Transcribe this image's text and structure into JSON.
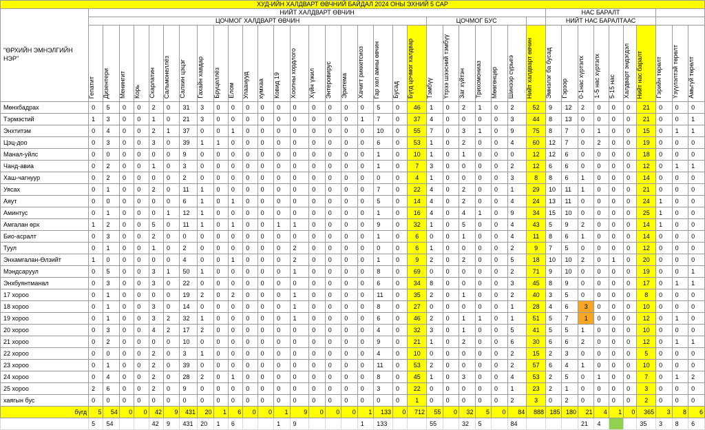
{
  "title": "ХУД-ИЙН ХАЛДВАРТ ӨВЧНИЙ БАЙДАЛ 2024 ОНЫ ЭХНИЙ 5 САР",
  "header_groups": {
    "total_infectious": "НИЙТ ХАЛДВАРТ ӨВЧИН",
    "acute_infectious": "ЦОЧМОГ ХАЛДВАРТ ӨВЧИН",
    "acute_other": "ЦОЧМОГ БУС",
    "deaths": "НАС БАРАЛТ",
    "of_total_deaths": "НИЙТ НАС БАРАЛТААС",
    "row_header": "\"ӨРХИЙН ЭМНЭЛГИЙН НЭР\""
  },
  "columns": [
    "Гепатит",
    "Дизентери",
    "Менингит",
    "Корь",
    "Скарлатин",
    "Сальмонеллёз",
    "Салхин цэцэг",
    "Гахайн хавдар",
    "Бруцеллёз",
    "Ёлом",
    "Улаанууд",
    "хумхаа",
    "Ковид 19",
    "Хоолны хордлого",
    "Хүйн үжил",
    "Энтеровирус",
    "Эритема",
    "Хачигт риккетсиоз",
    "Гар хөл амны өвчин",
    "Бусад",
    "Бүгд цочмог халдвар",
    "Тэмбүү",
    "Үтрээ шээсний тэмбүү",
    "Заг хүйтэн",
    "Трихомониаз",
    "Мөөгөнцөр",
    "Шинээр сүрьеэ",
    "Нийт халдварт өвчин",
    "Эмнэлэг ба бусад",
    "Гэрээр",
    "0-1нас хүртэлх",
    "1-5 нас хүртэлх",
    "5-15 нас",
    "Халдварт эндэгдэл",
    "Нийт нас баралт",
    "Гэрийн төрөлт",
    "Үзүүлэлтэй төрөлт",
    "Амьгүй төрөлт"
  ],
  "highlight_cols": [
    20,
    27,
    34
  ],
  "rows": [
    {
      "name": "Мөнхбадрах",
      "v": [
        "0",
        "5",
        "0",
        "0",
        "2",
        "0",
        "31",
        "3",
        "0",
        "0",
        "0",
        "0",
        "0",
        "0",
        "0",
        "0",
        "0",
        "0",
        "5",
        "0",
        "46",
        "1",
        "0",
        "2",
        "1",
        "0",
        "2",
        "52",
        "9",
        "12",
        "2",
        "0",
        "0",
        "0",
        "21",
        "0",
        "0",
        "0"
      ]
    },
    {
      "name": "Тэрмэстий",
      "v": [
        "1",
        "3",
        "0",
        "0",
        "1",
        "0",
        "21",
        "3",
        "0",
        "0",
        "0",
        "0",
        "0",
        "0",
        "0",
        "0",
        "0",
        "1",
        "7",
        "0",
        "37",
        "4",
        "0",
        "0",
        "0",
        "0",
        "3",
        "44",
        "8",
        "13",
        "0",
        "0",
        "0",
        "0",
        "21",
        "0",
        "0",
        "1"
      ]
    },
    {
      "name": "Энхтитэм",
      "v": [
        "0",
        "4",
        "0",
        "0",
        "2",
        "1",
        "37",
        "0",
        "0",
        "1",
        "0",
        "0",
        "0",
        "0",
        "0",
        "0",
        "0",
        "0",
        "10",
        "0",
        "55",
        "7",
        "0",
        "3",
        "1",
        "0",
        "9",
        "75",
        "8",
        "7",
        "0",
        "1",
        "0",
        "0",
        "15",
        "0",
        "1",
        "1"
      ]
    },
    {
      "name": "Цэц-доо",
      "v": [
        "0",
        "3",
        "0",
        "0",
        "3",
        "0",
        "39",
        "1",
        "1",
        "0",
        "0",
        "0",
        "0",
        "0",
        "0",
        "0",
        "0",
        "0",
        "6",
        "0",
        "53",
        "1",
        "0",
        "2",
        "0",
        "0",
        "4",
        "60",
        "12",
        "7",
        "0",
        "2",
        "0",
        "0",
        "19",
        "0",
        "0",
        "0"
      ]
    },
    {
      "name": "Манал-уйлс",
      "v": [
        "0",
        "0",
        "0",
        "0",
        "0",
        "0",
        "9",
        "0",
        "0",
        "0",
        "0",
        "0",
        "0",
        "0",
        "0",
        "0",
        "0",
        "0",
        "1",
        "0",
        "10",
        "1",
        "0",
        "1",
        "0",
        "0",
        "0",
        "12",
        "12",
        "6",
        "0",
        "0",
        "0",
        "0",
        "18",
        "0",
        "0",
        "0"
      ]
    },
    {
      "name": "Чанд-авиа",
      "v": [
        "0",
        "2",
        "0",
        "0",
        "1",
        "0",
        "3",
        "0",
        "0",
        "0",
        "0",
        "0",
        "0",
        "0",
        "0",
        "0",
        "0",
        "0",
        "1",
        "0",
        "7",
        "3",
        "0",
        "0",
        "0",
        "0",
        "2",
        "12",
        "6",
        "6",
        "0",
        "0",
        "0",
        "0",
        "12",
        "0",
        "1",
        "1"
      ]
    },
    {
      "name": "Хаш-чагнуур",
      "v": [
        "0",
        "2",
        "0",
        "0",
        "0",
        "0",
        "2",
        "0",
        "0",
        "0",
        "0",
        "0",
        "0",
        "0",
        "0",
        "0",
        "0",
        "0",
        "0",
        "0",
        "4",
        "1",
        "0",
        "0",
        "0",
        "0",
        "3",
        "8",
        "8",
        "6",
        "1",
        "0",
        "0",
        "0",
        "14",
        "0",
        "0",
        "0"
      ]
    },
    {
      "name": "Уясах",
      "v": [
        "0",
        "1",
        "0",
        "0",
        "2",
        "0",
        "11",
        "1",
        "0",
        "0",
        "0",
        "0",
        "0",
        "0",
        "0",
        "0",
        "0",
        "0",
        "7",
        "0",
        "22",
        "4",
        "0",
        "2",
        "0",
        "0",
        "1",
        "29",
        "10",
        "11",
        "1",
        "0",
        "0",
        "0",
        "21",
        "0",
        "0",
        "0"
      ]
    },
    {
      "name": "Аяут",
      "v": [
        "0",
        "0",
        "0",
        "0",
        "0",
        "0",
        "6",
        "1",
        "0",
        "1",
        "0",
        "0",
        "0",
        "0",
        "0",
        "0",
        "0",
        "0",
        "5",
        "0",
        "14",
        "4",
        "0",
        "2",
        "0",
        "0",
        "4",
        "24",
        "13",
        "11",
        "0",
        "0",
        "0",
        "0",
        "24",
        "1",
        "0",
        "0"
      ]
    },
    {
      "name": "Аминтус",
      "v": [
        "0",
        "1",
        "0",
        "0",
        "0",
        "1",
        "12",
        "1",
        "0",
        "0",
        "0",
        "0",
        "0",
        "0",
        "0",
        "0",
        "0",
        "0",
        "1",
        "0",
        "16",
        "4",
        "0",
        "4",
        "1",
        "0",
        "9",
        "34",
        "15",
        "10",
        "0",
        "0",
        "0",
        "0",
        "25",
        "1",
        "0",
        "0"
      ]
    },
    {
      "name": "Амгалан өрх",
      "v": [
        "1",
        "2",
        "0",
        "0",
        "5",
        "0",
        "11",
        "1",
        "0",
        "1",
        "0",
        "0",
        "1",
        "1",
        "0",
        "0",
        "0",
        "0",
        "9",
        "0",
        "32",
        "1",
        "0",
        "5",
        "0",
        "0",
        "4",
        "43",
        "5",
        "9",
        "2",
        "0",
        "0",
        "0",
        "14",
        "1",
        "0",
        "0"
      ]
    },
    {
      "name": "Био-асралт",
      "v": [
        "0",
        "3",
        "0",
        "0",
        "2",
        "0",
        "0",
        "0",
        "0",
        "0",
        "0",
        "0",
        "0",
        "0",
        "0",
        "0",
        "0",
        "0",
        "1",
        "0",
        "6",
        "0",
        "0",
        "1",
        "0",
        "0",
        "4",
        "11",
        "8",
        "6",
        "1",
        "0",
        "0",
        "0",
        "14",
        "0",
        "0",
        "0"
      ]
    },
    {
      "name": "Туул",
      "v": [
        "0",
        "1",
        "0",
        "0",
        "1",
        "0",
        "2",
        "0",
        "0",
        "0",
        "0",
        "0",
        "0",
        "2",
        "0",
        "0",
        "0",
        "0",
        "0",
        "0",
        "6",
        "1",
        "0",
        "0",
        "0",
        "0",
        "2",
        "9",
        "7",
        "5",
        "0",
        "0",
        "0",
        "0",
        "12",
        "0",
        "0",
        "0"
      ]
    },
    {
      "name": "Энхамгалан-Өлзийт",
      "v": [
        "1",
        "0",
        "0",
        "0",
        "0",
        "0",
        "4",
        "0",
        "0",
        "1",
        "0",
        "0",
        "0",
        "2",
        "0",
        "0",
        "0",
        "0",
        "1",
        "0",
        "9",
        "2",
        "0",
        "2",
        "0",
        "0",
        "5",
        "18",
        "10",
        "10",
        "2",
        "0",
        "1",
        "0",
        "20",
        "0",
        "0",
        "0"
      ]
    },
    {
      "name": "Мэндсаруул",
      "v": [
        "0",
        "5",
        "0",
        "0",
        "3",
        "1",
        "50",
        "1",
        "0",
        "0",
        "0",
        "0",
        "0",
        "1",
        "0",
        "0",
        "0",
        "0",
        "8",
        "0",
        "69",
        "0",
        "0",
        "0",
        "0",
        "0",
        "2",
        "71",
        "9",
        "10",
        "0",
        "0",
        "0",
        "0",
        "19",
        "0",
        "0",
        "1"
      ]
    },
    {
      "name": "Энхбуянтманал",
      "v": [
        "0",
        "3",
        "0",
        "0",
        "3",
        "0",
        "22",
        "0",
        "0",
        "0",
        "0",
        "0",
        "0",
        "0",
        "0",
        "0",
        "0",
        "0",
        "6",
        "0",
        "34",
        "8",
        "0",
        "0",
        "0",
        "0",
        "3",
        "45",
        "8",
        "9",
        "0",
        "0",
        "0",
        "0",
        "17",
        "0",
        "1",
        "1"
      ]
    },
    {
      "name": "17 хороо",
      "v": [
        "0",
        "1",
        "0",
        "0",
        "0",
        "0",
        "19",
        "2",
        "0",
        "2",
        "0",
        "0",
        "0",
        "1",
        "0",
        "0",
        "0",
        "0",
        "11",
        "0",
        "35",
        "2",
        "0",
        "1",
        "0",
        "0",
        "2",
        "40",
        "3",
        "5",
        "0",
        "0",
        "0",
        "0",
        "8",
        "0",
        "0",
        "0"
      ]
    },
    {
      "name": "18 хороо",
      "v": [
        "0",
        "1",
        "0",
        "0",
        "3",
        "0",
        "14",
        "0",
        "0",
        "0",
        "0",
        "0",
        "0",
        "1",
        "0",
        "0",
        "0",
        "0",
        "8",
        "0",
        "27",
        "0",
        "0",
        "0",
        "0",
        "0",
        "1",
        "28",
        "4",
        "6",
        "3",
        "0",
        "0",
        "0",
        "10",
        "0",
        "0",
        "0"
      ]
    },
    {
      "name": "19 хороо",
      "v": [
        "0",
        "1",
        "0",
        "0",
        "3",
        "2",
        "32",
        "1",
        "0",
        "0",
        "0",
        "0",
        "0",
        "1",
        "0",
        "0",
        "0",
        "0",
        "6",
        "0",
        "46",
        "2",
        "0",
        "1",
        "1",
        "0",
        "1",
        "51",
        "5",
        "7",
        "1",
        "0",
        "0",
        "0",
        "12",
        "0",
        "1",
        "0"
      ]
    },
    {
      "name": "20 хороо",
      "v": [
        "0",
        "3",
        "0",
        "0",
        "4",
        "2",
        "17",
        "2",
        "0",
        "0",
        "0",
        "0",
        "0",
        "0",
        "0",
        "0",
        "0",
        "0",
        "4",
        "0",
        "32",
        "3",
        "0",
        "1",
        "0",
        "0",
        "5",
        "41",
        "5",
        "5",
        "1",
        "0",
        "0",
        "0",
        "10",
        "0",
        "0",
        "0"
      ]
    },
    {
      "name": "21 хороо",
      "v": [
        "0",
        "2",
        "0",
        "0",
        "0",
        "0",
        "10",
        "0",
        "0",
        "0",
        "0",
        "0",
        "0",
        "0",
        "0",
        "0",
        "0",
        "0",
        "9",
        "0",
        "21",
        "1",
        "0",
        "2",
        "0",
        "0",
        "6",
        "30",
        "6",
        "6",
        "2",
        "0",
        "0",
        "0",
        "12",
        "0",
        "1",
        "1"
      ]
    },
    {
      "name": "22 хороо",
      "v": [
        "0",
        "0",
        "0",
        "0",
        "2",
        "0",
        "3",
        "1",
        "0",
        "0",
        "0",
        "0",
        "0",
        "0",
        "0",
        "0",
        "0",
        "0",
        "4",
        "0",
        "10",
        "0",
        "0",
        "0",
        "0",
        "0",
        "2",
        "15",
        "2",
        "3",
        "0",
        "0",
        "0",
        "0",
        "5",
        "0",
        "0",
        "0"
      ]
    },
    {
      "name": "23 хороо",
      "v": [
        "0",
        "1",
        "0",
        "0",
        "2",
        "0",
        "39",
        "0",
        "0",
        "0",
        "0",
        "0",
        "0",
        "0",
        "0",
        "0",
        "0",
        "0",
        "11",
        "0",
        "53",
        "2",
        "0",
        "0",
        "0",
        "0",
        "2",
        "57",
        "6",
        "4",
        "1",
        "0",
        "0",
        "0",
        "10",
        "0",
        "0",
        "0"
      ]
    },
    {
      "name": "24 хороо",
      "v": [
        "0",
        "4",
        "0",
        "0",
        "2",
        "0",
        "28",
        "2",
        "0",
        "1",
        "0",
        "0",
        "0",
        "0",
        "0",
        "0",
        "0",
        "0",
        "8",
        "0",
        "45",
        "1",
        "0",
        "3",
        "0",
        "0",
        "4",
        "53",
        "2",
        "5",
        "0",
        "1",
        "0",
        "0",
        "7",
        "0",
        "1",
        "2"
      ]
    },
    {
      "name": "25 хороо",
      "v": [
        "2",
        "6",
        "0",
        "0",
        "2",
        "0",
        "9",
        "0",
        "0",
        "0",
        "0",
        "0",
        "0",
        "0",
        "0",
        "0",
        "0",
        "0",
        "3",
        "0",
        "22",
        "0",
        "0",
        "0",
        "0",
        "0",
        "1",
        "23",
        "2",
        "1",
        "0",
        "0",
        "0",
        "0",
        "3",
        "0",
        "0",
        "0"
      ]
    },
    {
      "name": "хаягын бус",
      "v": [
        "0",
        "0",
        "0",
        "0",
        "0",
        "0",
        "0",
        "0",
        "0",
        "0",
        "0",
        "0",
        "0",
        "0",
        "0",
        "0",
        "0",
        "0",
        "0",
        "0",
        "1",
        "0",
        "0",
        "0",
        "0",
        "0",
        "2",
        "3",
        "0",
        "2",
        "0",
        "0",
        "0",
        "0",
        "2",
        "0",
        "0",
        "0"
      ]
    }
  ],
  "orange_cells": [
    [
      17,
      30
    ],
    [
      18,
      30
    ]
  ],
  "total": {
    "name": "бүгд",
    "v": [
      "5",
      "54",
      "0",
      "0",
      "42",
      "9",
      "431",
      "20",
      "1",
      "6",
      "0",
      "0",
      "1",
      "9",
      "0",
      "0",
      "0",
      "1",
      "133",
      "0",
      "712",
      "55",
      "0",
      "32",
      "5",
      "0",
      "84",
      "888",
      "185",
      "180",
      "21",
      "4",
      "1",
      "0",
      "365",
      "3",
      "8",
      "6"
    ]
  },
  "extra": {
    "v": [
      "5",
      "54",
      "",
      "",
      "42",
      "9",
      "431",
      "20",
      "1",
      "6",
      "",
      "",
      "1",
      "9",
      "",
      "",
      "",
      "1",
      "133",
      "",
      "",
      "55",
      "",
      "32",
      "5",
      "",
      "84",
      "",
      "",
      "",
      "21",
      "4",
      "",
      "",
      "35",
      "3",
      "8",
      "6"
    ]
  }
}
